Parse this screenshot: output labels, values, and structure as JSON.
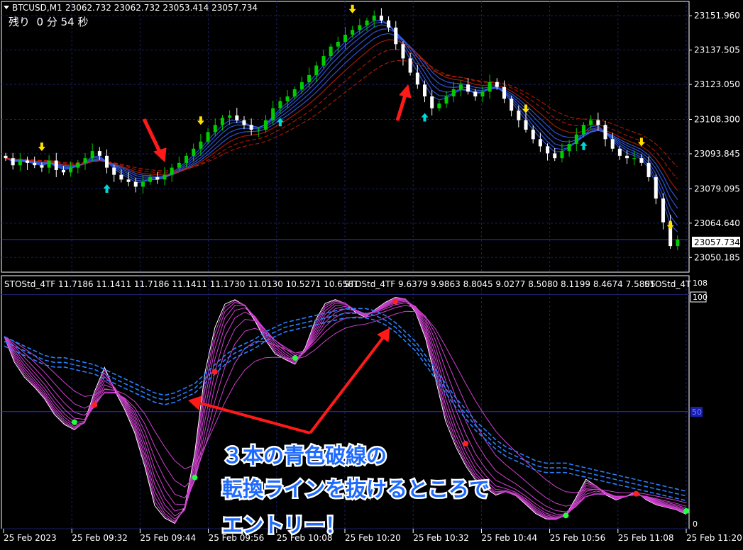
{
  "header": {
    "symbol": "BTCUSD,M1",
    "ohlc": "23062.732 23062.732 23053.414 23057.734",
    "remaining": "残り  0 分 54 秒"
  },
  "price_axis": {
    "ticks": [
      "23151.960",
      "23137.505",
      "23123.050",
      "23108.300",
      "23093.845",
      "23079.095",
      "23064.640",
      "23050.185"
    ],
    "current_price": "23057.734"
  },
  "indicator": {
    "legend": [
      "STOStd_4TF 11.7186 11.1411 11.7186 11.1411 11.1730 11.0130 10.5271 10.6561",
      "STOStd_4TF 9.6379 9.9863 8.8045 9.0277 8.5080 8.1199 8.4674 7.5805",
      "STOStd_4T"
    ],
    "axis_labels": [
      "108",
      "100",
      "50",
      "0"
    ]
  },
  "time_axis": {
    "labels": [
      "25 Feb 2023",
      "25 Feb 09:32",
      "25 Feb 09:44",
      "25 Feb 09:56",
      "25 Feb 10:08",
      "25 Feb 10:20",
      "25 Feb 10:32",
      "25 Feb 10:44",
      "25 Feb 10:56",
      "25 Feb 11:08",
      "25 Feb 11:20"
    ]
  },
  "annotation": {
    "lines": [
      "３本の青色破線の",
      "転換ラインを抜けるところで",
      "エントリー！"
    ]
  },
  "colors": {
    "background": "#000000",
    "grid": "#1a1f66",
    "bull_candle": "#00cc00",
    "bear_candle": "#ffffff",
    "ribbon_bull": "#3a66ff",
    "ribbon_bear": "#cc1f00",
    "stoch_fan": "#d040d0",
    "stoch_slow": "#2a7fff",
    "arrow_annotation": "#ff1a1a",
    "text_annotation": "#1f6bff"
  },
  "chart_data": [
    {
      "type": "candlestick",
      "title": "BTCUSD,M1",
      "ylim": [
        23044.0,
        23158.0
      ],
      "y_ticks": [
        23151.96,
        23137.505,
        23123.05,
        23108.3,
        23093.845,
        23079.095,
        23064.64,
        23050.185
      ],
      "current_price": 23057.734,
      "x_labels": [
        "25 Feb 2023",
        "25 Feb 09:32",
        "25 Feb 09:44",
        "25 Feb 09:56",
        "25 Feb 10:08",
        "25 Feb 10:20",
        "25 Feb 10:32",
        "25 Feb 10:44",
        "25 Feb 10:56",
        "25 Feb 11:08",
        "25 Feb 11:20"
      ],
      "close_path": [
        23092,
        23089,
        23091,
        23090,
        23089,
        23088,
        23091,
        23087,
        23086,
        23088,
        23090,
        23092,
        23095,
        23093,
        23088,
        23085,
        23083,
        23082,
        23080,
        23082,
        23084,
        23083,
        23085,
        23088,
        23090,
        23093,
        23096,
        23099,
        23103,
        23106,
        23109,
        23110,
        23108,
        23106,
        23104,
        23104,
        23108,
        23113,
        23116,
        23118,
        23121,
        23124,
        23127,
        23131,
        23135,
        23139,
        23141,
        23144,
        23146,
        23148,
        23150,
        23152,
        23150,
        23147,
        23140,
        23134,
        23128,
        23123,
        23118,
        23113,
        23115,
        23118,
        23121,
        23123,
        23120,
        23118,
        23120,
        23124,
        23122,
        23117,
        23112,
        23108,
        23104,
        23100,
        23097,
        23094,
        23092,
        23095,
        23098,
        23102,
        23106,
        23108,
        23106,
        23100,
        23096,
        23093,
        23092,
        23092,
        23090,
        23084,
        23075,
        23065,
        23055,
        23057.734
      ],
      "grid": true
    },
    {
      "type": "line",
      "title": "STOStd_4TF",
      "ylim": [
        0,
        108
      ],
      "y_ticks": [
        108,
        100,
        50,
        0
      ],
      "series_fast": [
        82,
        70,
        64,
        60,
        55,
        48,
        44,
        42,
        46,
        60,
        70,
        58,
        50,
        40,
        25,
        8,
        4,
        2,
        10,
        35,
        70,
        88,
        97,
        98,
        95,
        88,
        80,
        74,
        72,
        70,
        78,
        90,
        97,
        98,
        96,
        92,
        90,
        94,
        97,
        99,
        98,
        92,
        80,
        62,
        44,
        34,
        26,
        20,
        17,
        14,
        16,
        14,
        10,
        6,
        4,
        4,
        6,
        14,
        22,
        18,
        14,
        12,
        14,
        16,
        12,
        10,
        9,
        8,
        6
      ],
      "series_slow": [
        78,
        76,
        74,
        72,
        70,
        69,
        69,
        68,
        67,
        66,
        64,
        62,
        60,
        58,
        56,
        54,
        53,
        54,
        56,
        58,
        62,
        66,
        70,
        73,
        75,
        77,
        80,
        82,
        84,
        85,
        86,
        87,
        88,
        89,
        90,
        90,
        90,
        89,
        87,
        84,
        80,
        76,
        70,
        64,
        58,
        52,
        47,
        42,
        38,
        34,
        31,
        29,
        27,
        25,
        24,
        24,
        24,
        23,
        22,
        21,
        20,
        19,
        18,
        17,
        16,
        15,
        14,
        13,
        12
      ],
      "levels": [
        100,
        50,
        0
      ]
    }
  ]
}
